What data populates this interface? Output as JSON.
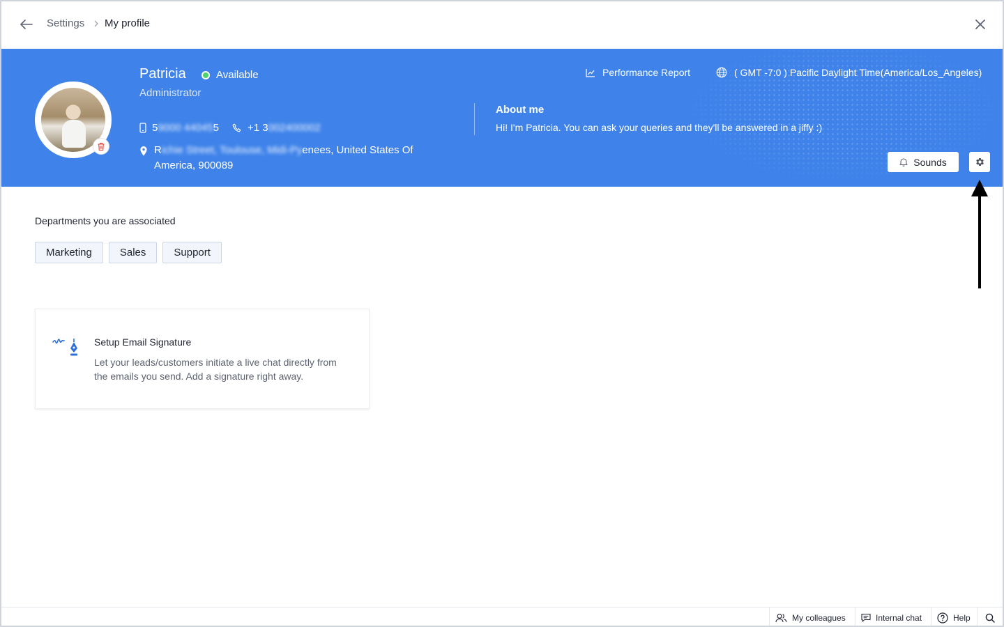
{
  "breadcrumb": {
    "parent": "Settings",
    "current": "My profile"
  },
  "profile": {
    "name": "Patricia",
    "status": "Available",
    "role": "Administrator",
    "mobile_start": "5",
    "mobile_blurred": "9000 44045",
    "mobile_end": "5",
    "phone_start": "+1 3",
    "phone_blurred": "002400002",
    "address_start": "R",
    "address_blurred": "ichie Street, Toulouse, Midi-Py",
    "address_end": "enees, United States Of",
    "address_line2": "America, 900089",
    "about_title": "About me",
    "about_text": "Hi! I'm Patricia. You can ask your queries and they'll be answered in a jiffy :)",
    "performance_label": "Performance Report",
    "timezone_label": "( GMT -7:0 ) Pacific Daylight Time(America/Los_Angeles)",
    "sounds_label": "Sounds"
  },
  "departments": {
    "title": "Departments you are associated",
    "items": [
      "Marketing",
      "Sales",
      "Support"
    ]
  },
  "signature_card": {
    "title": "Setup Email Signature",
    "description": "Let your leads/customers initiate a live chat directly from the emails you send. Add a signature right away."
  },
  "bottom_bar": {
    "colleagues": "My colleagues",
    "internal_chat": "Internal chat",
    "help": "Help"
  },
  "colors": {
    "banner": "#3f83ea",
    "status_green": "#4ed36d",
    "accent_blue": "#2f6fd8"
  }
}
